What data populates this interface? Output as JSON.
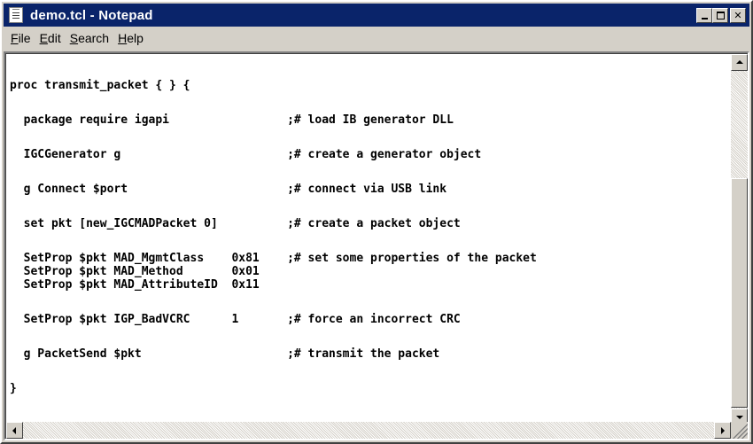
{
  "window": {
    "title": "demo.tcl - Notepad"
  },
  "menu": [
    {
      "label": "File",
      "key": "F",
      "rest": "ile"
    },
    {
      "label": "Edit",
      "key": "E",
      "rest": "dit"
    },
    {
      "label": "Search",
      "key": "S",
      "rest": "earch"
    },
    {
      "label": "Help",
      "key": "H",
      "rest": "elp"
    }
  ],
  "code": {
    "lines": [
      "proc transmit_packet { } {",
      "",
      "  package require igapi                 ;# load IB generator DLL",
      "",
      "  IGCGenerator g                        ;# create a generator object",
      "",
      "  g Connect $port                       ;# connect via USB link",
      "",
      "  set pkt [new_IGCMADPacket 0]          ;# create a packet object",
      "",
      "  SetProp $pkt MAD_MgmtClass    0x81    ;# set some properties of the packet",
      "  SetProp $pkt MAD_Method       0x01",
      "  SetProp $pkt MAD_AttributeID  0x11",
      "",
      "  SetProp $pkt IGP_BadVCRC      1       ;# force an incorrect CRC",
      "",
      "  g PacketSend $pkt                     ;# transmit the packet",
      "",
      "}"
    ]
  },
  "colors": {
    "titlebar": "#0a246a",
    "chrome": "#d4d0c8",
    "editor_bg": "#ffffff"
  },
  "icons": {
    "app": "notepad-icon",
    "minimize": "minimize-icon",
    "maximize": "maximize-icon",
    "close": "close-icon"
  }
}
